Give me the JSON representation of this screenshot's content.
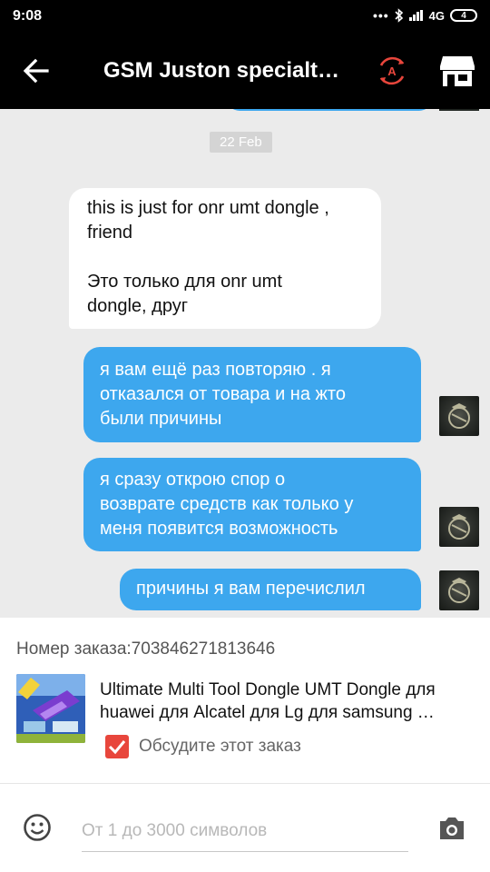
{
  "status_bar": {
    "time": "9:08",
    "network": "4G",
    "battery": "4"
  },
  "header": {
    "title": "GSM Juston specialt…",
    "back_icon": "arrow-left-icon",
    "translate_icon": "translate-a-icon",
    "store_icon": "store-icon"
  },
  "chat": {
    "date": "22 Feb",
    "messages": [
      {
        "side": "incoming",
        "lines": [
          "this is just for onr umt dongle ,",
          "friend",
          "",
          "Это только для onr umt",
          "dongle, друг"
        ]
      },
      {
        "side": "outgoing",
        "lines": [
          "я вам ещё раз повторяю . я",
          "отказался от товара и на жто",
          "были причины"
        ]
      },
      {
        "side": "outgoing",
        "lines": [
          "я сразу открою спор о",
          "возврате средств как только у",
          "меня появится возможность"
        ]
      },
      {
        "side": "outgoing",
        "lines": [
          "причины я вам перечислил"
        ]
      }
    ]
  },
  "order": {
    "number_label": "Номер заказа:703846271813646",
    "product_title_lines": [
      "Ultimate Multi Tool Dongle UMT Dongle для",
      "huawei для Alcatel для Lg для samsung …"
    ],
    "discuss_label": "Обсудите этот заказ",
    "discuss_checked": true
  },
  "composer": {
    "placeholder": "От 1 до 3000 символов",
    "emoji_icon": "emoji-icon",
    "camera_icon": "camera-icon"
  },
  "colors": {
    "header_bg": "#000000",
    "outgoing_bubble": "#3da7ee",
    "incoming_bubble": "#ffffff",
    "accent_red": "#e8463c",
    "chat_bg": "#ebebeb"
  }
}
